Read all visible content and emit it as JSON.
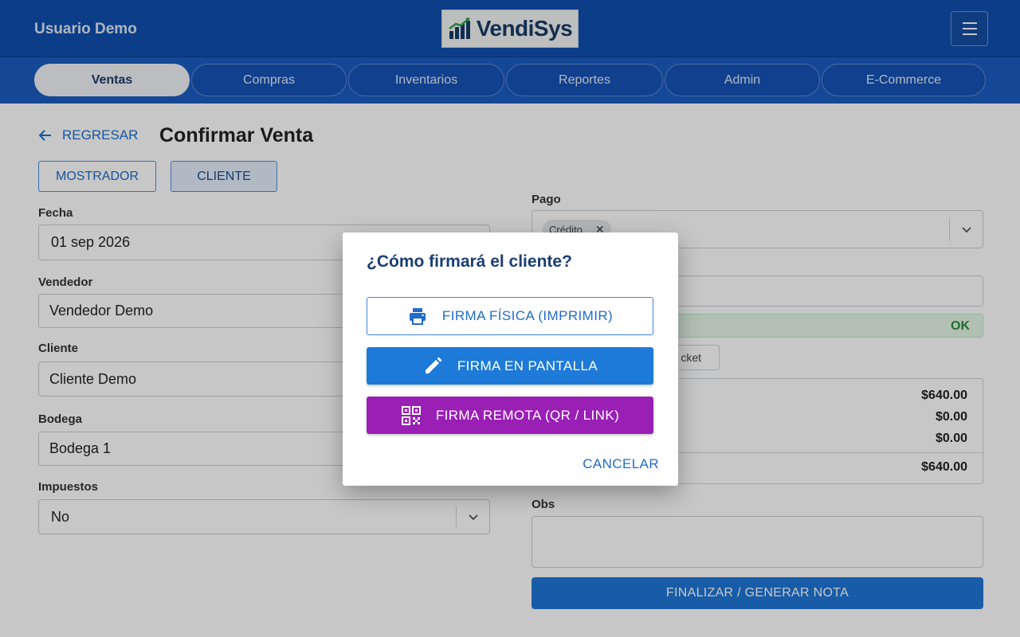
{
  "header": {
    "user_name": "Usuario Demo",
    "logo_text": "VendiSys",
    "menu_icon": "hamburger-icon"
  },
  "nav": {
    "tabs": [
      {
        "label": "Ventas",
        "active": true
      },
      {
        "label": "Compras",
        "active": false
      },
      {
        "label": "Inventarios",
        "active": false
      },
      {
        "label": "Reportes",
        "active": false
      },
      {
        "label": "Admin",
        "active": false
      },
      {
        "label": "E-Commerce",
        "active": false
      }
    ]
  },
  "page": {
    "back_label": "REGRESAR",
    "title": "Confirmar Venta",
    "mode_buttons": [
      {
        "label": "MOSTRADOR",
        "active": false
      },
      {
        "label": "CLIENTE",
        "active": true
      }
    ]
  },
  "form": {
    "fecha_label": "Fecha",
    "fecha_value": "01 sep 2026",
    "vendedor_label": "Vendedor",
    "vendedor_value": "Vendedor Demo",
    "cliente_label": "Cliente",
    "cliente_value": "Cliente Demo",
    "bodega_label": "Bodega",
    "bodega_value": "Bodega 1",
    "impuestos_label": "Impuestos",
    "impuestos_value": "No"
  },
  "payment": {
    "pago_label": "Pago",
    "selected_chip": "Crédito",
    "status_text": "OK",
    "ticket_label": "cket",
    "totals": [
      "$640.00",
      "$0.00",
      "$0.00",
      "$640.00"
    ],
    "obs_label": "Obs",
    "finalize_label": "FINALIZAR / GENERAR NOTA"
  },
  "dialog": {
    "title": "¿Cómo firmará el cliente?",
    "options": [
      {
        "label": "FIRMA FÍSICA (IMPRIMIR)",
        "icon": "printer-icon"
      },
      {
        "label": "FIRMA EN PANTALLA",
        "icon": "pencil-icon"
      },
      {
        "label": "FIRMA REMOTA (QR / LINK)",
        "icon": "qr-code-icon"
      }
    ],
    "cancel_label": "CANCELAR"
  },
  "colors": {
    "header_blue": "#0f4fb0",
    "nav_blue": "#1a5cbf",
    "primary_blue": "#1e7ad8",
    "purple": "#9a1fb5",
    "success_green": "#2e8b3a"
  }
}
